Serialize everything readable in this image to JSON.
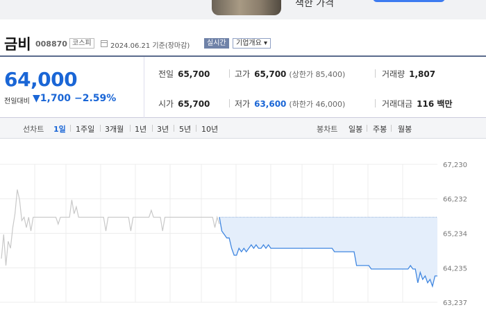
{
  "ad": {
    "text": "책한 가격"
  },
  "stock": {
    "name": "금비",
    "code": "008870",
    "market": "코스피",
    "date": "2024.06.21 기준(장마감)",
    "realtime_label": "실시간",
    "corp_info_label": "기업개요 ▾"
  },
  "quote": {
    "price": "64,000",
    "change_label": "전일대비",
    "change": "▼1,700",
    "change_pct": "−2.59%",
    "prev_close_label": "전일",
    "prev_close": "65,700",
    "open_label": "시가",
    "open": "65,700",
    "high_label": "고가",
    "high": "65,700",
    "upper_limit": "(상한가 85,400)",
    "low_label": "저가",
    "low": "63,600",
    "lower_limit": "(하한가 46,000)",
    "volume_label": "거래량",
    "volume": "1,807",
    "amount_label": "거래대금",
    "amount": "116 백만"
  },
  "tabs": {
    "line_label": "선차트",
    "periods": [
      "1일",
      "1주일",
      "3개월",
      "1년",
      "3년",
      "5년",
      "10년"
    ],
    "selected": "1일",
    "candle_label": "봉차트",
    "candles": [
      "일봉",
      "주봉",
      "월봉"
    ]
  },
  "colors": {
    "accent": "#1a66d6",
    "prev_line": "#c8c8c8",
    "today_line": "#3f86e0",
    "fill": "#e4eefb"
  },
  "chart_data": {
    "type": "line",
    "ylabel_ticks": [
      "67,230",
      "66,232",
      "65,234",
      "64,235",
      "63,237"
    ],
    "ylim": [
      63237,
      67230
    ],
    "grid": true,
    "series": [
      {
        "x": [
          0,
          1,
          2,
          3,
          4,
          5,
          6,
          7,
          8,
          9,
          10,
          11,
          12,
          13,
          14,
          15,
          16,
          17,
          18,
          19,
          20,
          21,
          22,
          23,
          24,
          25,
          26,
          27,
          28,
          29,
          30,
          31,
          32,
          33,
          34,
          35,
          36,
          37,
          38,
          39,
          40,
          41,
          42,
          43,
          44,
          45,
          46,
          47,
          48,
          49,
          50,
          51,
          52,
          53,
          54,
          55,
          56,
          57,
          58,
          59,
          60,
          61,
          62,
          63,
          64,
          65,
          66,
          67,
          68,
          69,
          70,
          71,
          72,
          73,
          74,
          75,
          76,
          77,
          78,
          79,
          80,
          81,
          82,
          83,
          84,
          85,
          86,
          87,
          88,
          89,
          90,
          91,
          92,
          93,
          94,
          95,
          96
        ],
        "y": [
          64500,
          65200,
          64300,
          65000,
          64800,
          65400,
          65800,
          66500,
          66200,
          65600,
          65700,
          65400,
          65700,
          65300,
          65700,
          65700,
          65700,
          65700,
          65700,
          65700,
          65700,
          65700,
          65700,
          65700,
          65700,
          65500,
          65700,
          65700,
          65700,
          65700,
          65700,
          66200,
          65800,
          66000,
          65700,
          65700,
          65700,
          65700,
          65700,
          65700,
          65700,
          65700,
          65700,
          65700,
          65700,
          65700,
          65300,
          65700,
          65700,
          65700,
          65700,
          65700,
          65700,
          65700,
          65700,
          65700,
          65700,
          65300,
          65700,
          65700,
          65700,
          65700,
          65700,
          65700,
          65700,
          65700,
          65900,
          65700,
          65700,
          65700,
          65700,
          65300,
          65700,
          65700,
          65700,
          65700,
          65700,
          65700,
          65700,
          65700,
          65700,
          65700,
          65700,
          65700,
          65700,
          65700,
          65700,
          65700,
          65700,
          65700,
          65700,
          65700,
          65700,
          65700,
          65400,
          65700,
          65500
        ]
      },
      {
        "x": [
          0,
          1,
          2,
          3,
          4,
          5,
          6,
          7,
          8,
          9,
          10,
          11,
          12,
          13,
          14,
          15,
          16,
          17,
          18,
          19,
          20,
          21,
          22,
          23,
          24,
          25,
          26,
          27,
          28,
          29,
          30,
          31,
          32,
          33,
          34,
          35,
          36,
          37,
          38,
          39,
          40,
          41,
          42,
          43,
          44,
          45,
          46,
          47,
          48,
          49,
          50,
          51,
          52,
          53,
          54,
          55,
          56,
          57,
          58,
          59,
          60,
          61,
          62,
          63,
          64,
          65,
          66,
          67,
          68,
          69,
          70,
          71,
          72,
          73,
          74,
          75,
          76,
          77,
          78,
          79,
          80,
          81,
          82,
          83,
          84,
          85,
          86,
          87,
          88,
          89
        ],
        "y": [
          65700,
          65300,
          65200,
          65100,
          65100,
          64800,
          64600,
          64600,
          64800,
          64700,
          64800,
          64700,
          64800,
          64900,
          64800,
          64900,
          64800,
          64800,
          64900,
          64800,
          64900,
          64800,
          64800,
          64800,
          64800,
          64800,
          64800,
          64800,
          64800,
          64800,
          64800,
          64800,
          64800,
          64800,
          64800,
          64800,
          64800,
          64800,
          64800,
          64800,
          64800,
          64800,
          64800,
          64800,
          64800,
          64800,
          64800,
          64700,
          64700,
          64700,
          64700,
          64700,
          64700,
          64700,
          64700,
          64700,
          64300,
          64300,
          64300,
          64300,
          64300,
          64300,
          64200,
          64200,
          64200,
          64200,
          64200,
          64200,
          64200,
          64200,
          64200,
          64200,
          64200,
          64200,
          64200,
          64200,
          64200,
          64200,
          64300,
          64200,
          64200,
          63800,
          64100,
          63900,
          64000,
          63800,
          63900,
          63700,
          64000,
          64000
        ]
      }
    ]
  }
}
